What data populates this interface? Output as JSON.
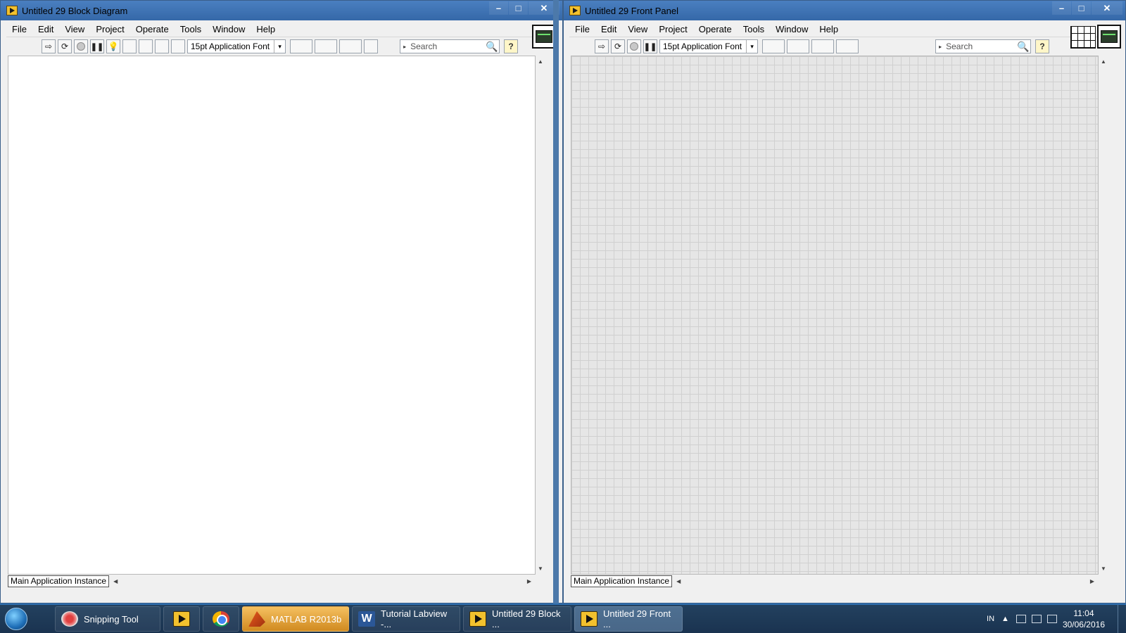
{
  "left_window": {
    "title": "Untitled 29 Block Diagram",
    "menu": [
      "File",
      "Edit",
      "View",
      "Project",
      "Operate",
      "Tools",
      "Window",
      "Help"
    ],
    "font_selector": "15pt Application Font",
    "search_placeholder": "Search",
    "status_instance": "Main Application Instance"
  },
  "right_window": {
    "title": "Untitled 29 Front Panel",
    "menu": [
      "File",
      "Edit",
      "View",
      "Project",
      "Operate",
      "Tools",
      "Window",
      "Help"
    ],
    "font_selector": "15pt Application Font",
    "search_placeholder": "Search",
    "status_instance": "Main Application Instance"
  },
  "window_controls": {
    "minimize": "–",
    "maximize": "□",
    "close": "✕"
  },
  "toolbar_glyphs": {
    "run": "⇨",
    "run_continuously": "⟳",
    "pause": "❚❚",
    "highlight": "💡",
    "help": "?",
    "search_icon": "🔍",
    "dropdown": "▾",
    "search_arrow": "▸"
  },
  "taskbar": {
    "items": [
      {
        "label": "Snipping Tool",
        "icon": "snipping-tool-icon"
      },
      {
        "label": "",
        "icon": "labview-icon"
      },
      {
        "label": "",
        "icon": "chrome-icon"
      },
      {
        "label": "MATLAB R2013b",
        "icon": "matlab-icon"
      },
      {
        "label": "Tutorial Labview -...",
        "icon": "word-icon"
      },
      {
        "label": "Untitled 29 Block ...",
        "icon": "labview-icon"
      },
      {
        "label": "Untitled 29 Front ...",
        "icon": "labview-icon"
      }
    ],
    "tray": {
      "language": "IN",
      "time": "11:04",
      "date": "30/06/2016"
    }
  },
  "colors": {
    "titlebar": "#3568a8",
    "taskbar": "#1a3350",
    "front_panel_grid": "#e6e6e6",
    "block_diagram_bg": "#ffffff"
  }
}
